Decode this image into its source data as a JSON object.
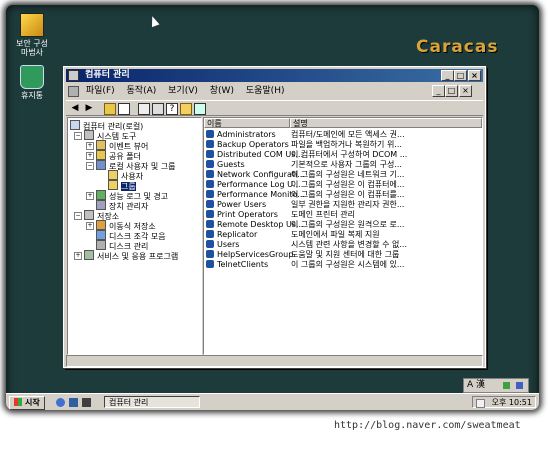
{
  "desktop": {
    "title": "Caracas",
    "icons": [
      {
        "label": "보안 구성 마법사",
        "icon": "security-wizard-icon"
      },
      {
        "label": "휴지통",
        "icon": "recycle-bin-icon"
      }
    ]
  },
  "window": {
    "title": "컴퓨터 관리",
    "controls": [
      "_",
      "□",
      "×"
    ],
    "menu": [
      "파일(F)",
      "동작(A)",
      "보기(V)",
      "창(W)",
      "도움말(H)"
    ],
    "inner_controls": [
      "_",
      "□",
      "×"
    ],
    "toolbar": [
      "back-icon",
      "forward-icon",
      "up-folder-icon",
      "console-tree-icon",
      "export-icon",
      "properties-icon",
      "help-icon",
      "new-icon",
      "view-icon"
    ]
  },
  "tree": [
    {
      "label": "컴퓨터 관리(로컬)",
      "level": 0,
      "expander": ""
    },
    {
      "label": "시스템 도구",
      "level": 1,
      "expander": "−"
    },
    {
      "label": "이벤트 뷰어",
      "level": 2,
      "expander": "+"
    },
    {
      "label": "공유 폴더",
      "level": 2,
      "expander": "+"
    },
    {
      "label": "로컬 사용자 및 그룹",
      "level": 2,
      "expander": "−"
    },
    {
      "label": "사용자",
      "level": 3,
      "expander": ""
    },
    {
      "label": "그룹",
      "level": 3,
      "expander": "",
      "selected": true
    },
    {
      "label": "성능 로그 및 경고",
      "level": 2,
      "expander": "+"
    },
    {
      "label": "장치 관리자",
      "level": 2,
      "expander": ""
    },
    {
      "label": "저장소",
      "level": 1,
      "expander": "−"
    },
    {
      "label": "이동식 저장소",
      "level": 2,
      "expander": "+"
    },
    {
      "label": "디스크 조각 모음",
      "level": 2,
      "expander": ""
    },
    {
      "label": "디스크 관리",
      "level": 2,
      "expander": ""
    },
    {
      "label": "서비스 및 응용 프로그램",
      "level": 1,
      "expander": "+"
    }
  ],
  "list": {
    "columns": [
      "이름",
      "설명"
    ],
    "rows": [
      {
        "name": "Administrators",
        "desc": "컴퓨터/도메인에 모든 액세스 권..."
      },
      {
        "name": "Backup Operators",
        "desc": "파일을 백업하거나 복원하기 위..."
      },
      {
        "name": "Distributed COM Us...",
        "desc": "이 컴퓨터에서 구성하여 DCOM ..."
      },
      {
        "name": "Guests",
        "desc": "기본적으로 사용자 그룹의 구성..."
      },
      {
        "name": "Network Configurati...",
        "desc": "이 그룹의 구성원은 네트워크 기..."
      },
      {
        "name": "Performance Log U...",
        "desc": "이 그룹의 구성원은 이 컴퓨터에..."
      },
      {
        "name": "Performance Monito...",
        "desc": "이 그룹의 구성원은 이 컴퓨터를..."
      },
      {
        "name": "Power Users",
        "desc": "일부 권한을 지원한 관리자 권한..."
      },
      {
        "name": "Print Operators",
        "desc": "도메인 프린터 관리"
      },
      {
        "name": "Remote Desktop Us...",
        "desc": "이 그룹의 구성원은 원격으로 로..."
      },
      {
        "name": "Replicator",
        "desc": "도메인에서 파일 복제 지원"
      },
      {
        "name": "Users",
        "desc": "시스템 관련 사항을 변경할 수 없..."
      },
      {
        "name": "HelpServicesGroup",
        "desc": "도움말 및 지원 센터에 대한 그룹"
      },
      {
        "name": "TelnetClients",
        "desc": "이 그룹의 구성원은 시스템에 있..."
      }
    ]
  },
  "taskbar": {
    "start_label": "시작",
    "task_label": "컴퓨터 관리",
    "clock": "오후 10:51",
    "lang_label": "A 漢"
  },
  "watermark": "http://blog.naver.com/sweatmeat"
}
